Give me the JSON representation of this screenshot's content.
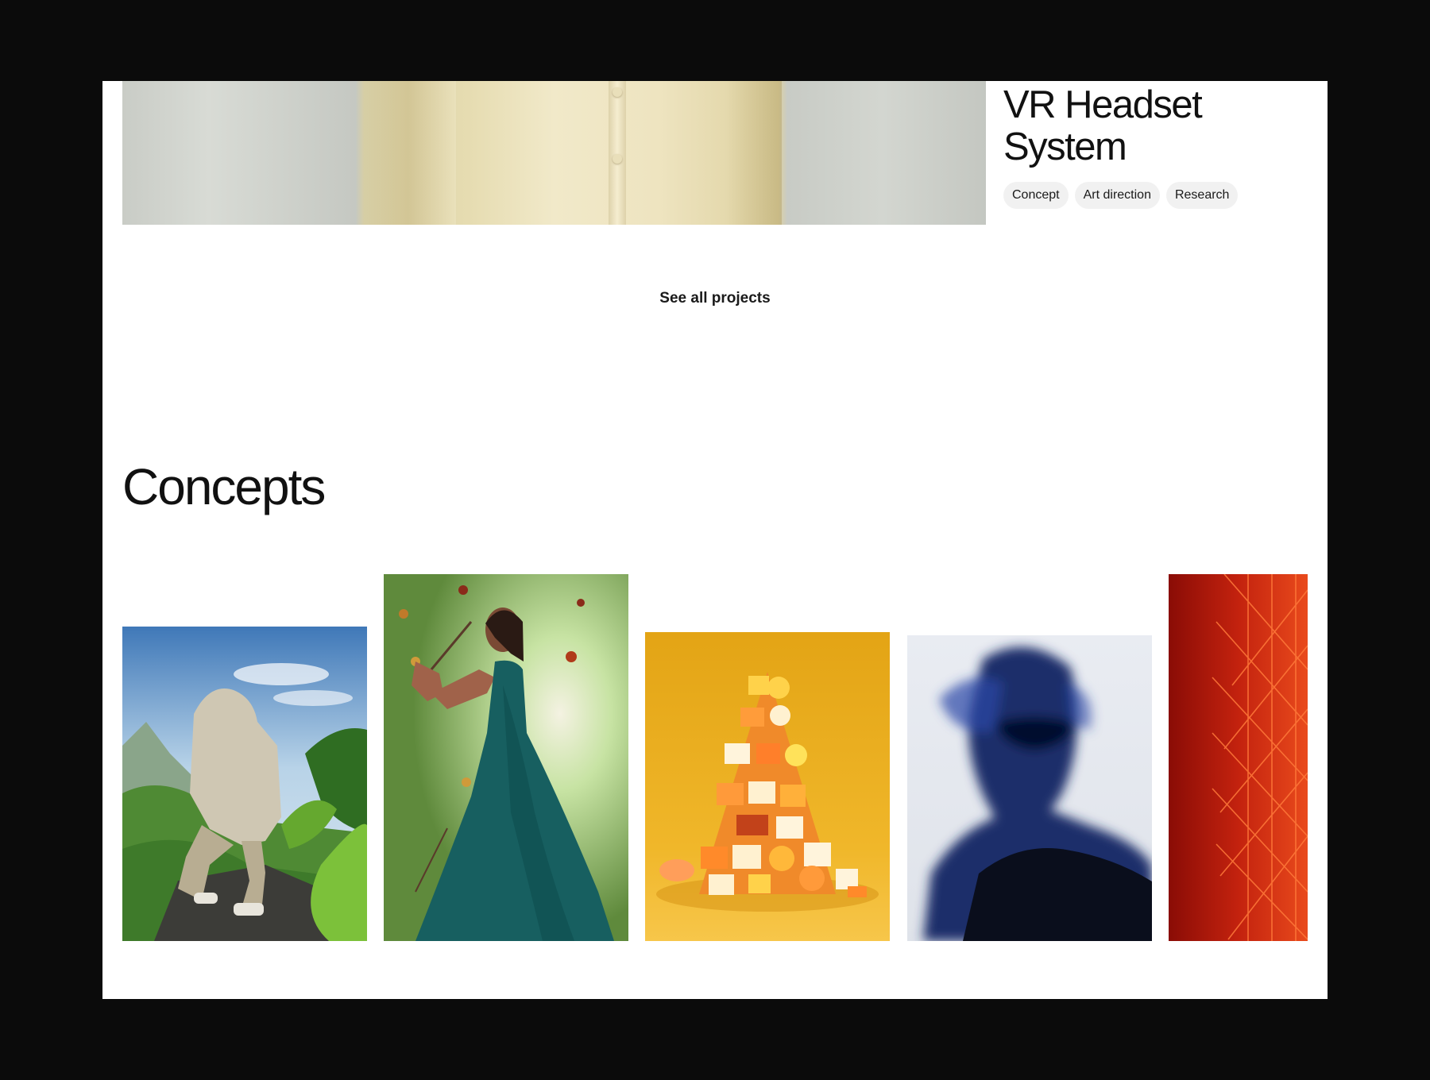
{
  "project": {
    "title": "VR Headset System",
    "image": "cream-shirt-photo",
    "tags": [
      "Concept",
      "Art direction",
      "Research"
    ]
  },
  "see_all_label": "See all projects",
  "concepts": {
    "title": "Concepts",
    "cards": [
      {
        "image": "hiker-in-green-valley-photo"
      },
      {
        "image": "woman-teal-dress-flowers-photo"
      },
      {
        "image": "stacked-orange-blocks-photo"
      },
      {
        "image": "blurred-silhouette-portrait-photo"
      },
      {
        "image": "red-grid-pattern-photo"
      }
    ]
  }
}
